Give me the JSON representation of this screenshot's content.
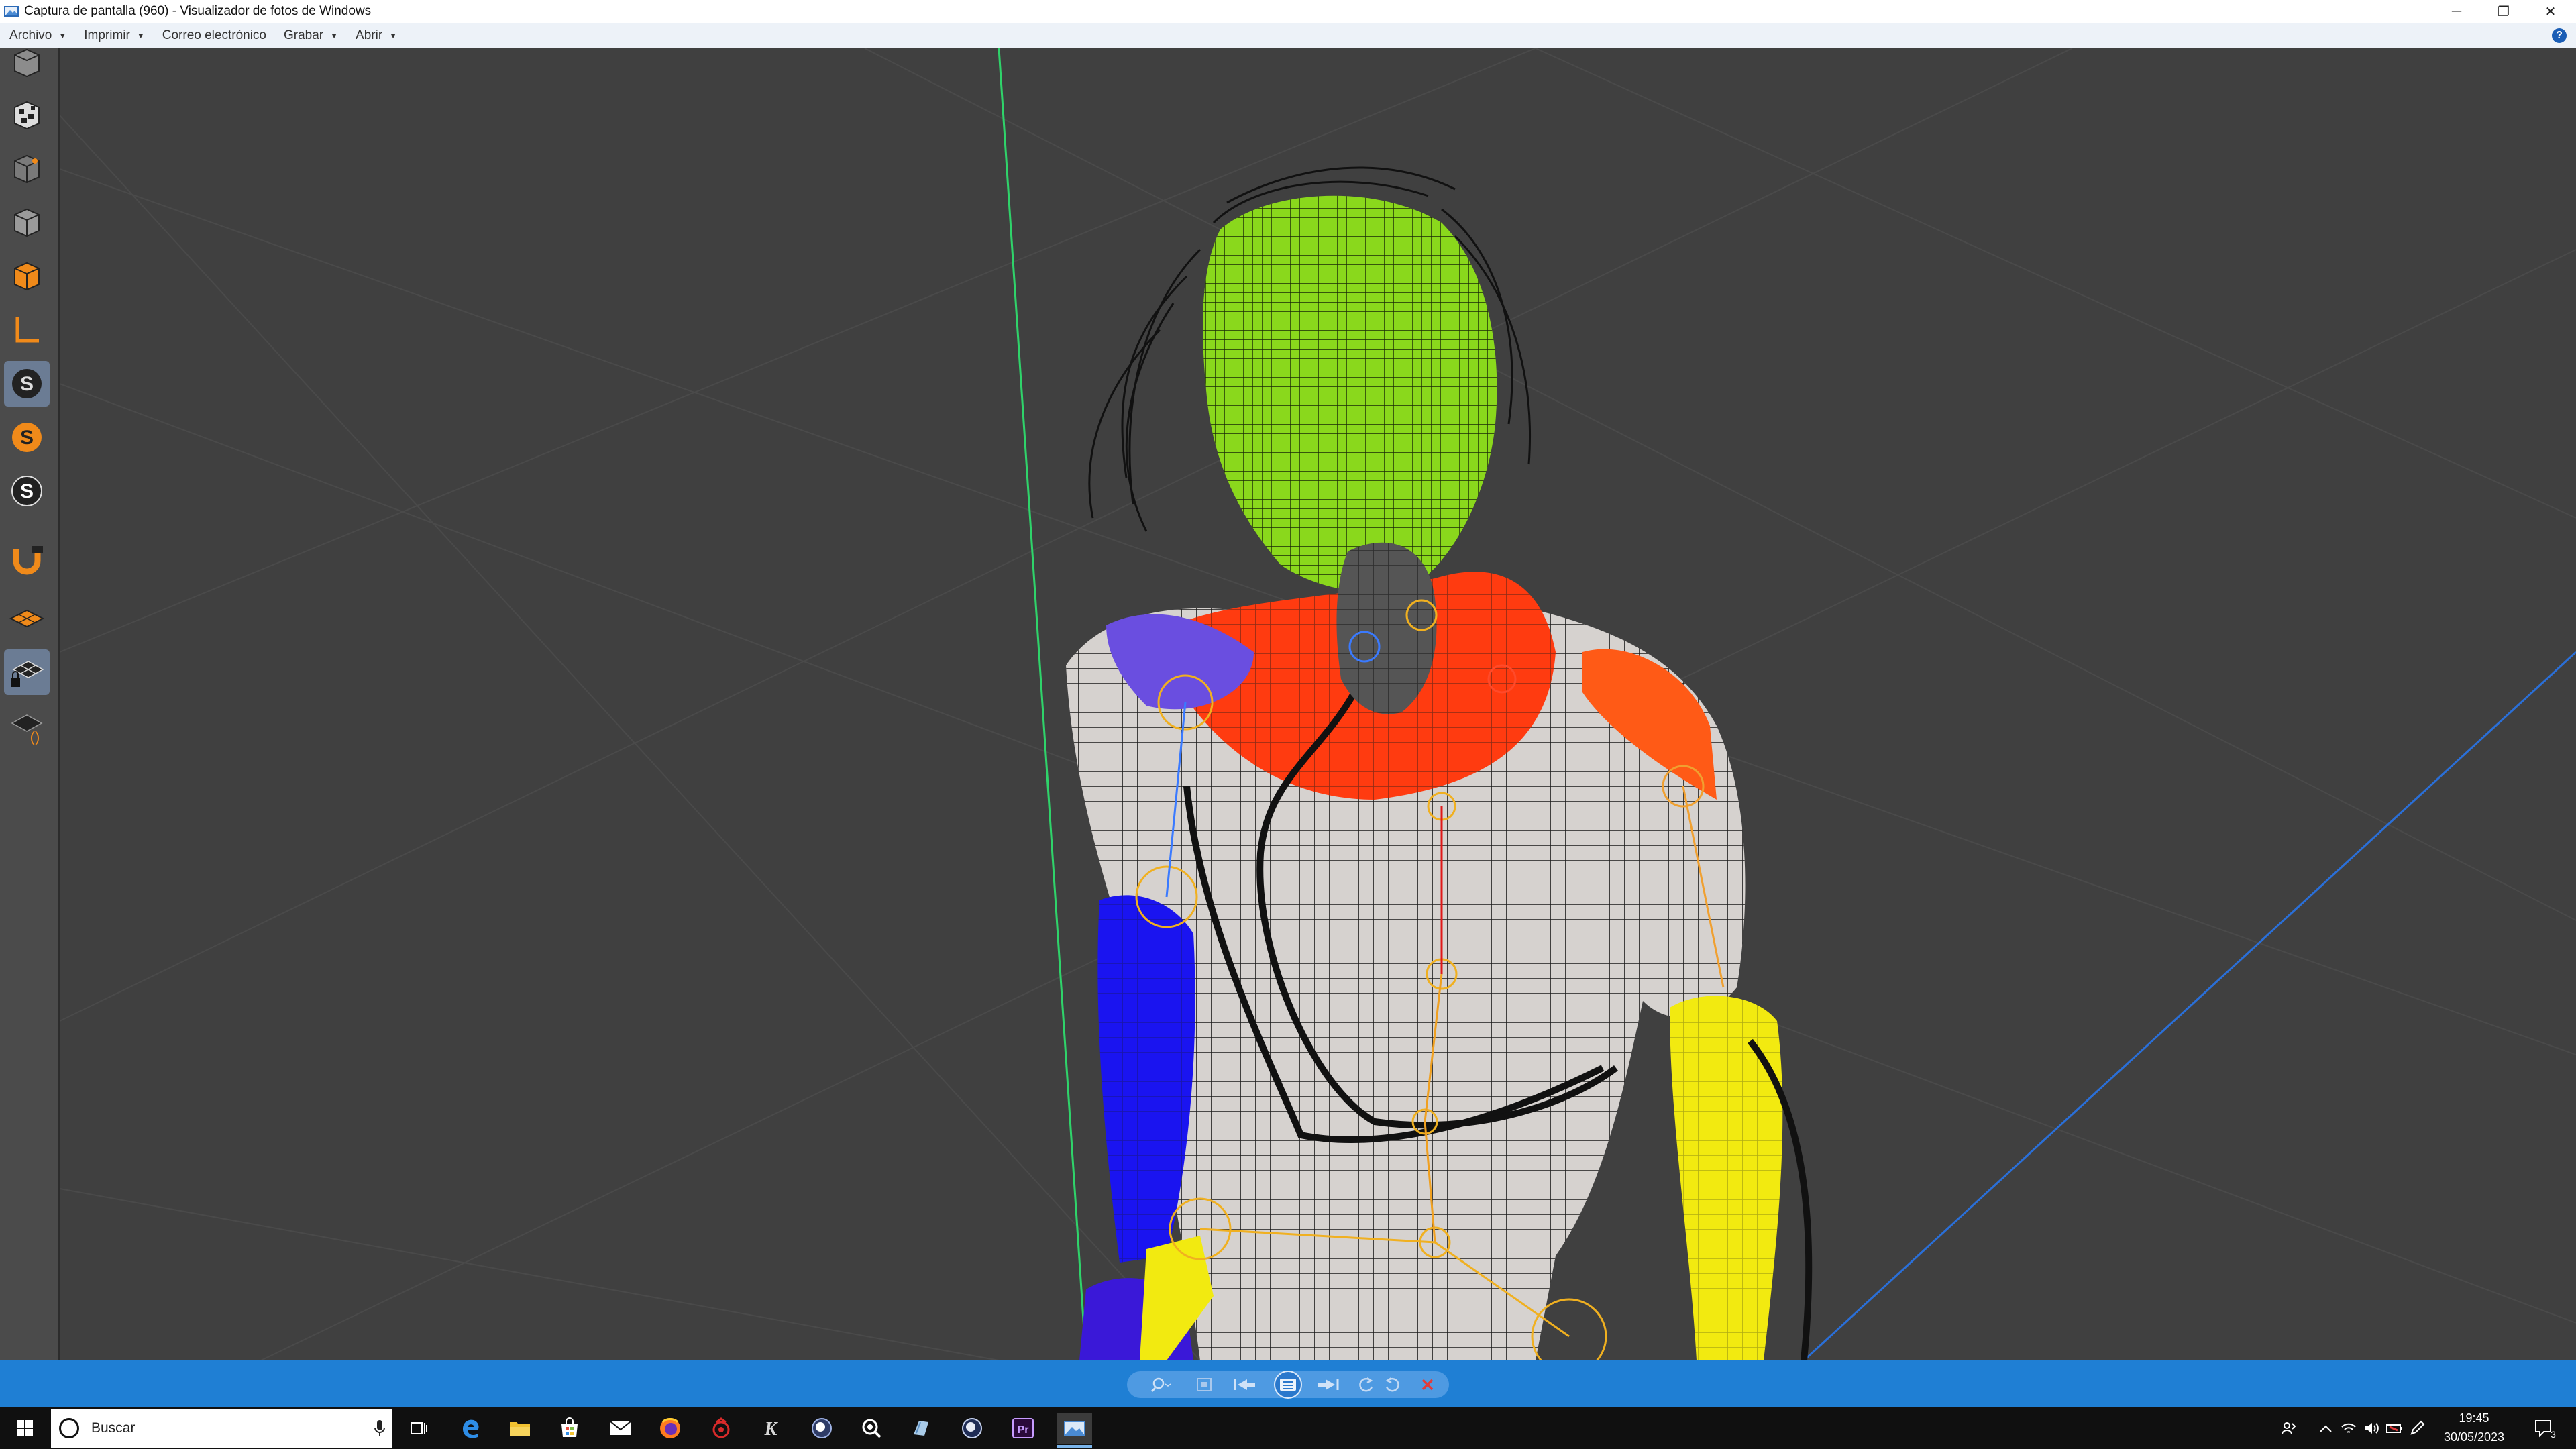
{
  "window": {
    "title": "Captura de pantalla (960) - Visualizador de fotos de Windows",
    "minimize": "─",
    "restore": "❐",
    "close": "✕"
  },
  "menu": {
    "items": [
      {
        "label": "Archivo"
      },
      {
        "label": "Imprimir"
      },
      {
        "label": "Correo electrónico"
      },
      {
        "label": "Grabar"
      },
      {
        "label": "Abrir"
      }
    ],
    "help": "?"
  },
  "sidebar_tools": [
    "cube-top-icon",
    "checker-cube-icon",
    "cube-wire-icon",
    "cube-gray-icon",
    "cube-orange-icon",
    "axis-l-icon",
    "snap-s-icon",
    "snap-s-orange-icon",
    "snap-s-white-icon",
    "magnet-icon",
    "grid-plane-icon",
    "grid-lock-icon",
    "grid-parens-icon"
  ],
  "viewer_controls": [
    "zoom-icon",
    "actual-size-icon",
    "previous-icon",
    "slideshow-icon",
    "next-icon",
    "rotate-left-icon",
    "rotate-right-icon",
    "delete-icon"
  ],
  "taskbar": {
    "search_placeholder": "Buscar",
    "time": "19:45",
    "date": "30/05/2023",
    "notification_count": "3"
  },
  "colors": {
    "viewport_bg": "#404040",
    "head": "#8ad81c",
    "shoulder_red": "#ff3b10",
    "arm_blue": "#1a14f0",
    "arm_yellow": "#f2ea10",
    "accent_blue": "#1f7fd4"
  }
}
